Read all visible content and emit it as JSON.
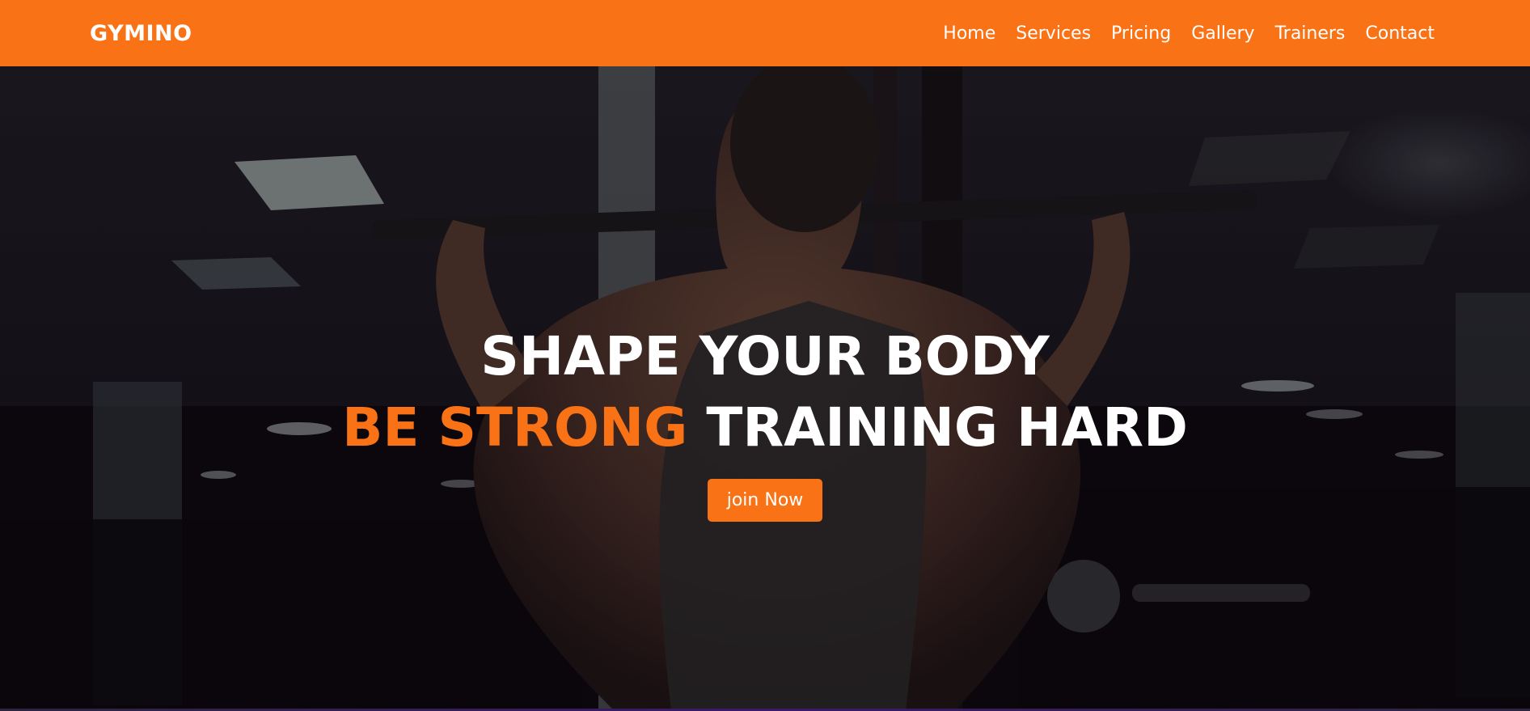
{
  "brand": {
    "name": "GYMINO",
    "color": "#f97316"
  },
  "nav": {
    "links": [
      {
        "label": "Home"
      },
      {
        "label": "Services"
      },
      {
        "label": "Pricing"
      },
      {
        "label": "Gallery"
      },
      {
        "label": "Trainers"
      },
      {
        "label": "Contact"
      }
    ]
  },
  "hero": {
    "line1": "SHAPE YOUR BODY",
    "line2_accent": "BE STRONG",
    "line2_rest": " TRAINING HARD",
    "cta_label": "join Now"
  }
}
